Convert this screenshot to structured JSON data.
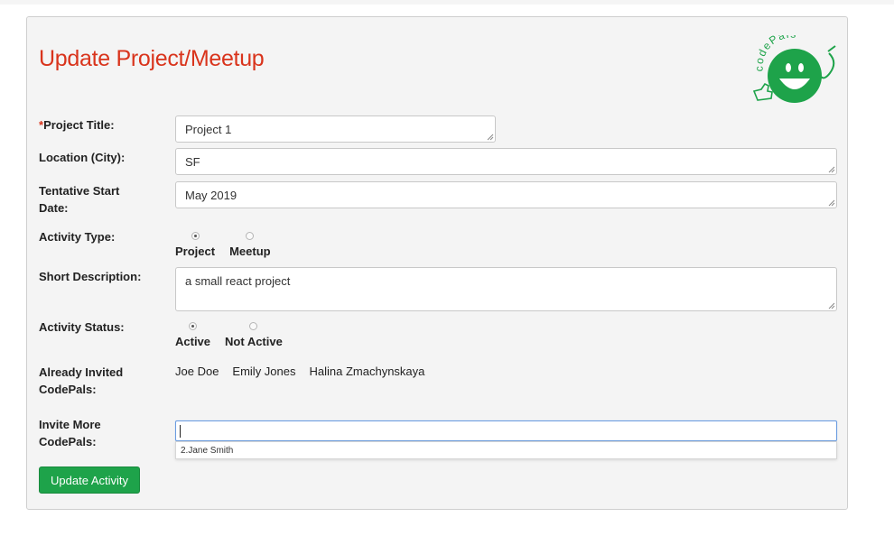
{
  "form": {
    "title": "Update Project/Meetup",
    "required_mark": "*",
    "labels": {
      "project_title": "Project Title:",
      "location": "Location (City):",
      "start_date_line1": "Tentative Start",
      "start_date_line2": "Date:",
      "activity_type": "Activity Type:",
      "short_description": "Short Description:",
      "activity_status": "Activity Status:",
      "already_invited_line1": "Already Invited",
      "already_invited_line2": "CodePals:",
      "invite_more_line1": "Invite More",
      "invite_more_line2": "CodePals:"
    },
    "values": {
      "project_title": "Project 1",
      "location": "SF",
      "start_date": "May 2019",
      "short_description": "a small react project",
      "invite_more": ""
    },
    "activity_type": {
      "options": [
        "Project",
        "Meetup"
      ],
      "selected": "Project"
    },
    "activity_status": {
      "options": [
        "Active",
        "Not Active"
      ],
      "selected": "Active"
    },
    "already_invited": [
      "Joe Doe",
      "Emily Jones",
      "Halina Zmachynskaya"
    ],
    "suggestions": [
      "2.Jane Smith"
    ],
    "submit_label": "Update Activity"
  },
  "logo": {
    "text": "codePals",
    "brand_color": "#1ea34a"
  },
  "colors": {
    "title": "#d9341c",
    "button": "#1ea34a",
    "focus_border": "#6c9de0"
  }
}
